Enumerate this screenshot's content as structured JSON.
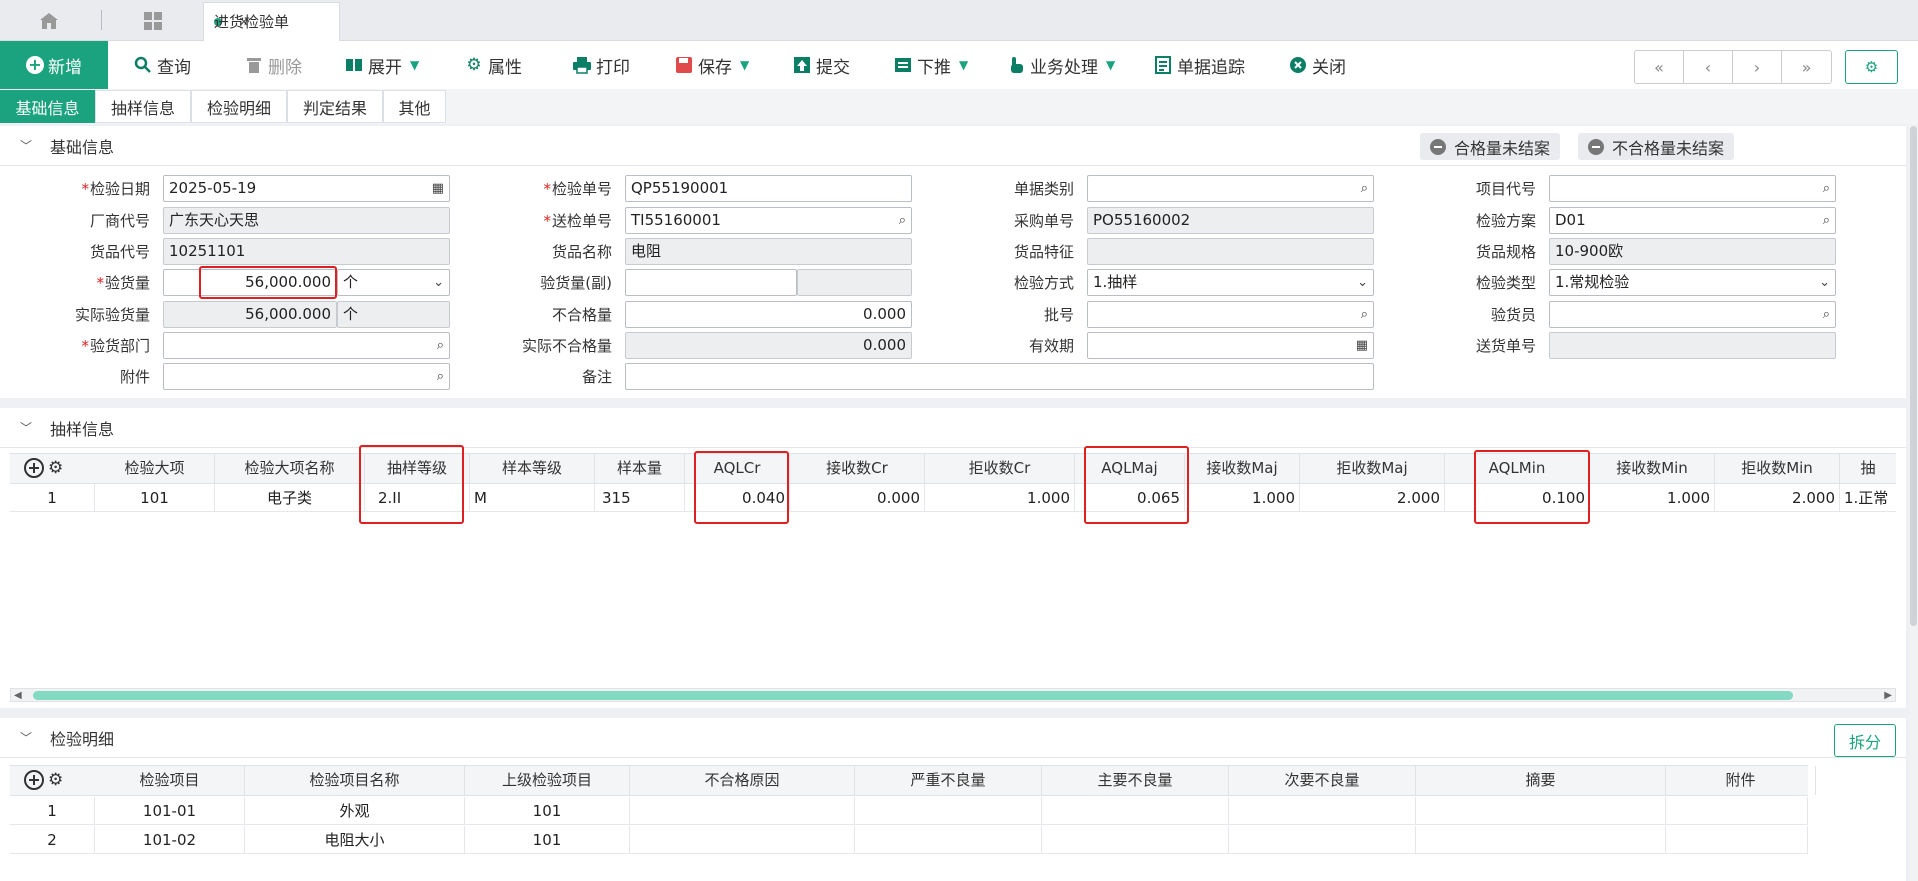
{
  "top_tab": {
    "label": "进货检验单",
    "close": "×"
  },
  "icons": {
    "home": "home-icon",
    "apps": "apps-grid-icon"
  },
  "colors": {
    "accent": "#1aa37e",
    "required": "#e02020",
    "highlight_box": "#e02020"
  },
  "toolbar": {
    "new": "新增",
    "query": "查询",
    "delete": "删除",
    "expand": "展开",
    "properties": "属性",
    "print": "打印",
    "save": "保存",
    "submit": "提交",
    "push_down": "下推",
    "business": "业务处理",
    "trace": "单据追踪",
    "close": "关闭"
  },
  "subtabs": [
    "基础信息",
    "抽样信息",
    "检验明细",
    "判定结果",
    "其他"
  ],
  "basic": {
    "title": "基础信息",
    "btn_qualified": "合格量未结案",
    "btn_unqualified": "不合格量未结案",
    "col1": {
      "date_label": "检验日期",
      "date": "2025-05-19",
      "vendor_label": "厂商代号",
      "vendor": "广东天心天思",
      "item_label": "货品代号",
      "item": "10251101",
      "qty_label": "验货量",
      "qty": "56,000.000",
      "qty_unit": "个",
      "actual_qty_label": "实际验货量",
      "actual_qty": "56,000.000",
      "actual_unit": "个",
      "dept_label": "验货部门",
      "dept": "",
      "attach_label": "附件",
      "attach": ""
    },
    "col2": {
      "inspect_no_label": "检验单号",
      "inspect_no": "QP55190001",
      "send_no_label": "送检单号",
      "send_no": "TI55160001",
      "item_name_label": "货品名称",
      "item_name": "电阻",
      "qty2_label": "验货量(副)",
      "qty2": "",
      "qty2_unit": "",
      "unqual_label": "不合格量",
      "unqual": "0.000",
      "actual_unqual_label": "实际不合格量",
      "actual_unqual": "0.000",
      "remark_label": "备注",
      "remark": ""
    },
    "col3": {
      "doc_type_label": "单据类别",
      "doc_type": "",
      "po_label": "采购单号",
      "po": "PO55160002",
      "feature_label": "货品特征",
      "feature": "",
      "method_label": "检验方式",
      "method": "1.抽样",
      "batch_label": "批号",
      "batch": "",
      "expiry_label": "有效期",
      "expiry": ""
    },
    "col4": {
      "project_label": "项目代号",
      "project": "",
      "scheme_label": "检验方案",
      "scheme": "D01",
      "spec_label": "货品规格",
      "spec": "10-900欧",
      "type_label": "检验类型",
      "type": "1.常规检验",
      "inspector_label": "验货员",
      "inspector": "",
      "delivery_label": "送货单号",
      "delivery": ""
    }
  },
  "sampling": {
    "title": "抽样信息",
    "columns": [
      "检验大项",
      "检验大项名称",
      "抽样等级",
      "样本等级",
      "样本量",
      "AQLCr",
      "接收数Cr",
      "拒收数Cr",
      "AQLMaj",
      "接收数Maj",
      "拒收数Maj",
      "AQLMin",
      "接收数Min",
      "拒收数Min",
      "抽"
    ],
    "rows": [
      {
        "no": "1",
        "cells": [
          "101",
          "电子类",
          "2.II",
          "M",
          "315",
          "0.040",
          "0.000",
          "1.000",
          "0.065",
          "1.000",
          "2.000",
          "0.100",
          "1.000",
          "2.000",
          "1.正常"
        ]
      }
    ]
  },
  "detail": {
    "title": "检验明细",
    "split": "拆分",
    "columns": [
      "检验项目",
      "检验项目名称",
      "上级检验项目",
      "不合格原因",
      "严重不良量",
      "主要不良量",
      "次要不良量",
      "摘要",
      "附件"
    ],
    "rows": [
      {
        "no": "1",
        "cells": [
          "101-01",
          "外观",
          "101",
          "",
          "",
          "",
          "",
          "",
          ""
        ]
      },
      {
        "no": "2",
        "cells": [
          "101-02",
          "电阻大小",
          "101",
          "",
          "",
          "",
          "",
          "",
          ""
        ]
      }
    ]
  }
}
